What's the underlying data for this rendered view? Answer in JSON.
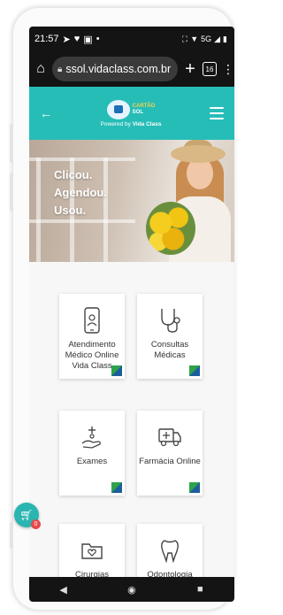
{
  "status_bar": {
    "time": "21:57",
    "network_badge": "5G"
  },
  "browser": {
    "url": "ssol.vidaclass.com.br",
    "tab_count": "16"
  },
  "site": {
    "logo_line1": "CARTÃO",
    "logo_line2": "SOL",
    "powered_by": "Powered by",
    "brand": "Vida Class"
  },
  "hero": {
    "line1": "Clicou.",
    "line2": "Agendou.",
    "line3": "Usou."
  },
  "services": [
    {
      "label": "Atendimento Médico Online Vida Class",
      "icon": "phone-doctor-icon"
    },
    {
      "label": "Consultas Médicas",
      "icon": "stethoscope-icon"
    },
    {
      "label": "Exames",
      "icon": "exam-hand-icon"
    },
    {
      "label": "Farmácia Online",
      "icon": "ambulance-icon"
    },
    {
      "label": "Cirurgias",
      "icon": "folder-heart-icon"
    },
    {
      "label": "Odontologia",
      "icon": "tooth-icon"
    }
  ],
  "cart": {
    "count": "0"
  },
  "colors": {
    "header": "#27bdb7",
    "accent_green": "#2ea24a",
    "accent_blue": "#1c5d9c",
    "badge_red": "#e8484a"
  }
}
